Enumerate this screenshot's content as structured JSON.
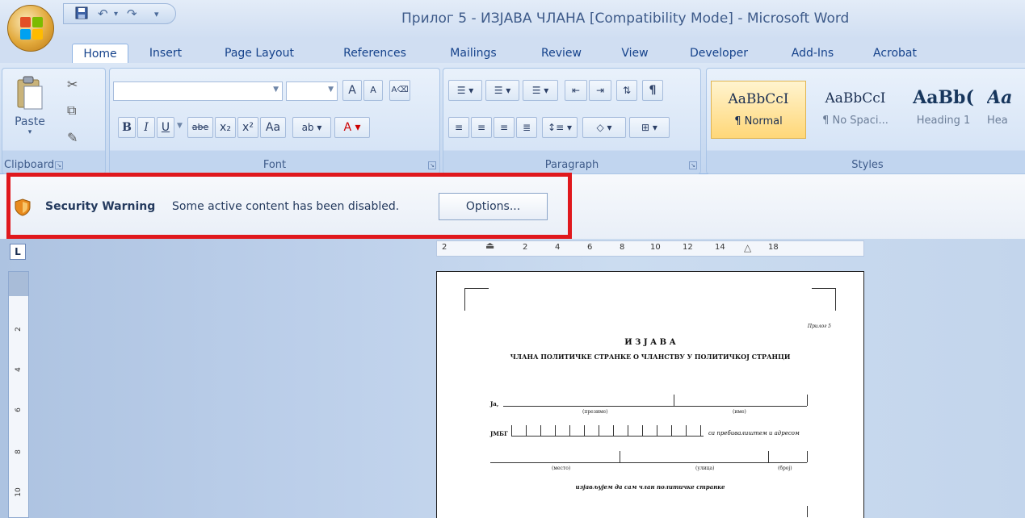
{
  "window": {
    "title": "Прилог 5 - ИЗЈАВА ЧЛАНА [Compatibility Mode] - Microsoft Word"
  },
  "qat": {
    "save_icon": "save-icon",
    "undo_icon": "undo-icon",
    "redo_icon": "redo-icon",
    "customize": "▾"
  },
  "tabs": [
    {
      "label": "Home",
      "active": true
    },
    {
      "label": "Insert"
    },
    {
      "label": "Page Layout"
    },
    {
      "label": "References"
    },
    {
      "label": "Mailings"
    },
    {
      "label": "Review"
    },
    {
      "label": "View"
    },
    {
      "label": "Developer"
    },
    {
      "label": "Add-Ins"
    },
    {
      "label": "Acrobat"
    }
  ],
  "clipboard": {
    "label": "Clipboard",
    "paste_label": "Paste"
  },
  "font": {
    "label": "Font",
    "font_name": "",
    "font_size": "",
    "grow": "A",
    "shrink": "A",
    "bold": "B",
    "italic": "I",
    "underline": "U",
    "strike": "abe",
    "subscript": "x₂",
    "superscript": "x²",
    "change_case": "Aa",
    "highlight": "ab",
    "color": "A"
  },
  "paragraph": {
    "label": "Paragraph",
    "show_marks": "¶"
  },
  "styles": {
    "label": "Styles",
    "items": [
      {
        "sample": "AaBbCcI",
        "name": "¶ Normal"
      },
      {
        "sample": "AaBbCcI",
        "name": "¶ No Spaci..."
      },
      {
        "sample": "AaBb(",
        "name": "Heading 1"
      },
      {
        "sample": "Aa",
        "name": "Hea"
      }
    ]
  },
  "security": {
    "title": "Security Warning",
    "message": "Some active content has been disabled.",
    "options_label": "Options..."
  },
  "ruler": {
    "h_labels": [
      "2",
      "2",
      "4",
      "6",
      "8",
      "10",
      "12",
      "14",
      "18"
    ],
    "v_labels": [
      "2",
      "4",
      "6",
      "8",
      "10"
    ],
    "tab_selector": "L"
  },
  "document": {
    "prilog": "Прилог 5",
    "heading": "И З Ј А В А",
    "subheading": "ЧЛАНА ПОЛИТИЧКЕ СТРАНКЕ О ЧЛАНСТВУ У ПОЛИТИЧКОЈ СТРАНЦИ",
    "ja": "Ја,",
    "prezime": "(презиме)",
    "ime": "(име)",
    "jmbg": "ЈМБГ",
    "prebivaliste": "са пребивалиштем и адресом",
    "mesto": "(место)",
    "ulica": "(улица)",
    "broj": "(број)",
    "izjava": "изјављујем да сам члан политичке странке"
  },
  "colors": {
    "accent": "#15428b",
    "warning_border": "#e0181d"
  }
}
